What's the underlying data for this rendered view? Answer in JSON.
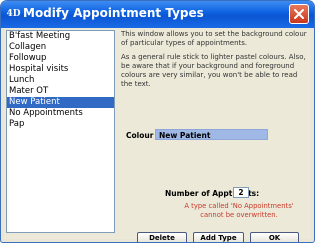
{
  "window": {
    "title": "Modify Appointment Types",
    "app_icon_text": "4D"
  },
  "appointment_types": [
    {
      "label": "B'fast Meeting",
      "selected": false
    },
    {
      "label": "Collagen",
      "selected": false
    },
    {
      "label": "Followup",
      "selected": false
    },
    {
      "label": "Hospital visits",
      "selected": false
    },
    {
      "label": "Lunch",
      "selected": false
    },
    {
      "label": "Mater OT",
      "selected": false
    },
    {
      "label": "New Patient",
      "selected": true
    },
    {
      "label": "No Appointments",
      "selected": false
    },
    {
      "label": "Pap",
      "selected": false
    }
  ],
  "info": {
    "paragraph1": "This window allows you to set the background colour of particular types of appointments.",
    "paragraph2": "As a general rule stick to lighter pastel colours. Also, be aware that if your background and foreground colours are very similar, you won't be able to read the text."
  },
  "colour": {
    "label": "Colour",
    "value": "New Patient",
    "swatch": "#9fb8e6"
  },
  "slots": {
    "label": "Number of Appt Slots:",
    "value": "2"
  },
  "warning": "A type called 'No Appointments' cannot be overwritten.",
  "buttons": {
    "delete": "Delete",
    "add_type": "Add Type",
    "ok": "OK"
  },
  "colors": {
    "titlebar": "#0a5fe0",
    "selection": "#316ac5",
    "warning": "#c83a2a"
  }
}
